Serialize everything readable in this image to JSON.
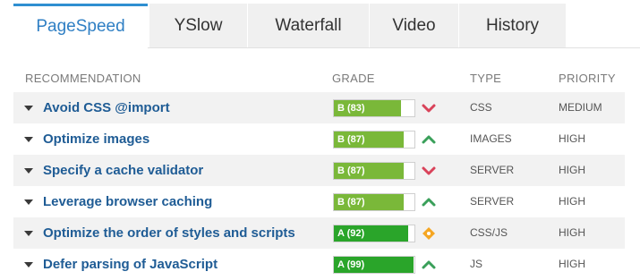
{
  "tabs": [
    {
      "label": "PageSpeed",
      "active": true
    },
    {
      "label": "YSlow"
    },
    {
      "label": "Waterfall"
    },
    {
      "label": "Video"
    },
    {
      "label": "History"
    }
  ],
  "columns": {
    "recommendation": "RECOMMENDATION",
    "grade": "GRADE",
    "type": "TYPE",
    "priority": "PRIORITY"
  },
  "colors": {
    "grade_b": "#7ab839",
    "grade_a": "#2aa52a",
    "down_arrow": "#d9435a",
    "up_arrow": "#3aa05a",
    "diamond": "#f5a623",
    "link": "#1f5c95",
    "tab_active": "#2f7fc4"
  },
  "rows": [
    {
      "recommendation": "Avoid CSS @import",
      "grade_label": "B (83)",
      "score": 83,
      "grade": "B",
      "trend_icon": "chevron-down-icon",
      "type": "CSS",
      "priority": "MEDIUM"
    },
    {
      "recommendation": "Optimize images",
      "grade_label": "B (87)",
      "score": 87,
      "grade": "B",
      "trend_icon": "chevron-up-icon",
      "type": "IMAGES",
      "priority": "HIGH"
    },
    {
      "recommendation": "Specify a cache validator",
      "grade_label": "B (87)",
      "score": 87,
      "grade": "B",
      "trend_icon": "chevron-down-icon",
      "type": "SERVER",
      "priority": "HIGH"
    },
    {
      "recommendation": "Leverage browser caching",
      "grade_label": "B (87)",
      "score": 87,
      "grade": "B",
      "trend_icon": "chevron-up-icon",
      "type": "SERVER",
      "priority": "HIGH"
    },
    {
      "recommendation": "Optimize the order of styles and scripts",
      "grade_label": "A (92)",
      "score": 92,
      "grade": "A",
      "trend_icon": "diamond-icon",
      "type": "CSS/JS",
      "priority": "HIGH"
    },
    {
      "recommendation": "Defer parsing of JavaScript",
      "grade_label": "A (99)",
      "score": 99,
      "grade": "A",
      "trend_icon": "chevron-up-icon",
      "type": "JS",
      "priority": "HIGH"
    }
  ]
}
